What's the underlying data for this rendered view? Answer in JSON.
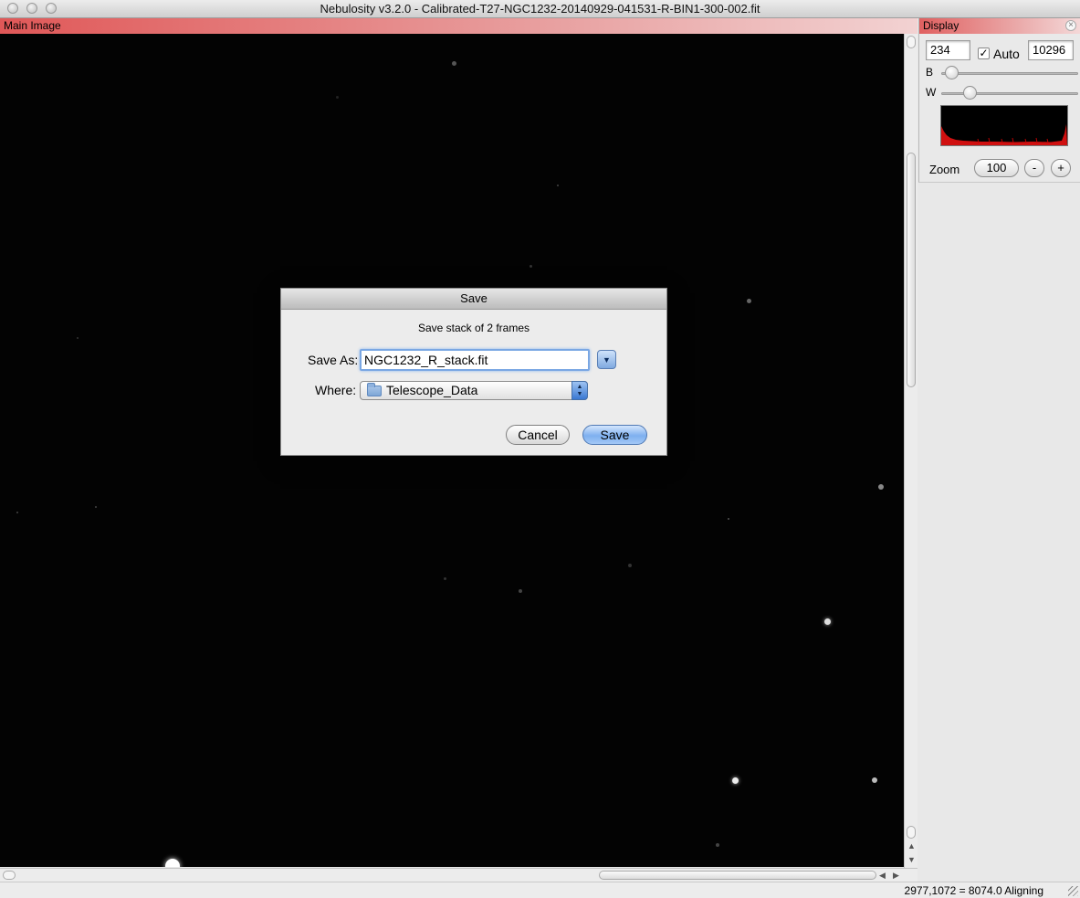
{
  "window": {
    "title": "Nebulosity v3.2.0 - Calibrated-T27-NGC1232-20140929-041531-R-BIN1-300-002.fit"
  },
  "main_panel": {
    "header": "Main Image"
  },
  "display_panel": {
    "header": "Display",
    "black_value": "234",
    "auto_label": "Auto",
    "auto_checked": "✓",
    "white_value": "10296",
    "b_label": "B",
    "w_label": "W",
    "b_slider_level": 0.03,
    "w_slider_level": 0.18,
    "zoom_label": "Zoom",
    "zoom_value": "100",
    "zoom_out_label": "-",
    "zoom_in_label": "+"
  },
  "dialog": {
    "title": "Save",
    "message": "Save stack of 2 frames",
    "save_as_label": "Save As:",
    "save_as_value": "NGC1232_R_stack.fit",
    "where_label": "Where:",
    "where_value": "Telescope_Data",
    "cancel_label": "Cancel",
    "save_label": "Save"
  },
  "status": {
    "text": "2977,1072 = 8074.0  Aligning"
  },
  "colors": {
    "panel_header_red": "#e05858",
    "histogram_fill": "#d01010",
    "focus_blue": "#7aa7e3"
  },
  "icons": [
    "folder-icon",
    "close-icon",
    "checkmark-icon",
    "chevron-down-icon",
    "up-down-arrows-icon"
  ]
}
